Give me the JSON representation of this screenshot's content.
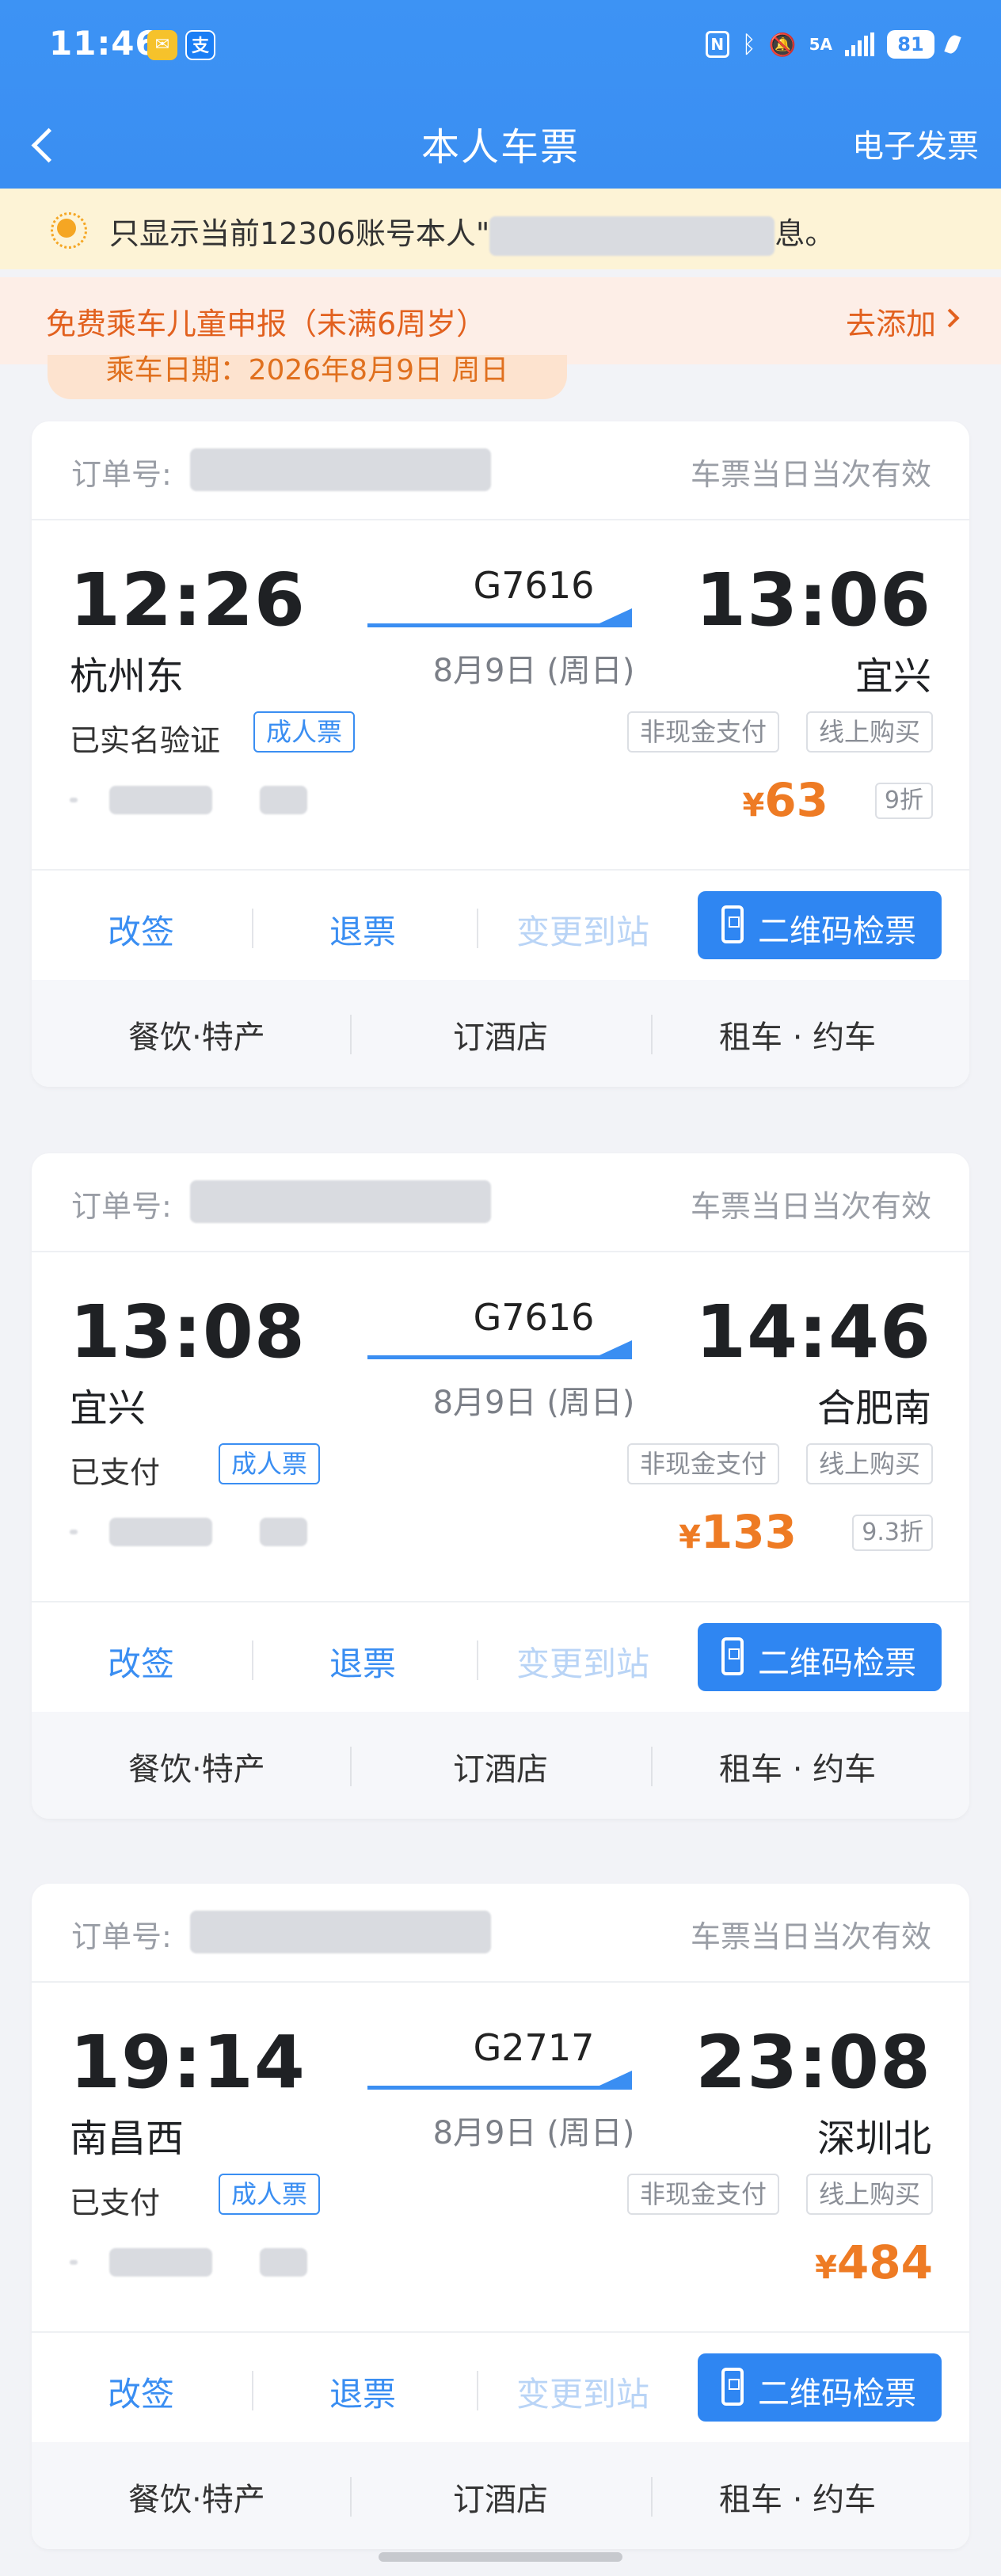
{
  "status_bar": {
    "time": "11:46",
    "net": "5A",
    "battery": "81"
  },
  "nav": {
    "title": "本人车票",
    "right": "电子发票"
  },
  "notice": {
    "prefix": "只显示当前12306账号本人\"",
    "suffix": "息。"
  },
  "child": {
    "text": "免费乘车儿童申报（未满6周岁）",
    "action": "去添加"
  },
  "date_tab": "乘车日期：2026年8月9日 周日",
  "common": {
    "order_label": "订单号:",
    "validity": "车票当日当次有效",
    "ticket_type": "成人票",
    "pay_tag": "非现金支付",
    "online_tag": "线上购买",
    "reschedule": "改签",
    "refund": "退票",
    "change_station": "变更到站",
    "qr": "二维码检票",
    "svc_food": "餐饮·特产",
    "svc_hotel": "订酒店",
    "svc_car": "租车 · 约车",
    "yen": "¥"
  },
  "tickets": [
    {
      "dep_time": "12:26",
      "dep_station": "杭州东",
      "arr_time": "13:06",
      "arr_station": "宜兴",
      "train": "G7616",
      "date": "8月9日 (周日)",
      "status": "已实名验证",
      "price": "63",
      "discount": "9折"
    },
    {
      "dep_time": "13:08",
      "dep_station": "宜兴",
      "arr_time": "14:46",
      "arr_station": "合肥南",
      "train": "G7616",
      "date": "8月9日 (周日)",
      "status": "已支付",
      "price": "133",
      "discount": "9.3折"
    },
    {
      "dep_time": "19:14",
      "dep_station": "南昌西",
      "arr_time": "23:08",
      "arr_station": "深圳北",
      "train": "G2717",
      "date": "8月9日 (周日)",
      "status": "已支付",
      "price": "484",
      "discount": ""
    }
  ]
}
